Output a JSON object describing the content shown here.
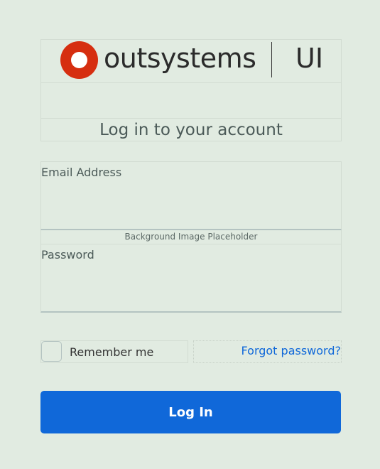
{
  "header": {
    "logo_icon": "outsystems-logo-icon",
    "logo_text": "outsystems",
    "logo_suffix": "UI",
    "brand_color": "#d62e10"
  },
  "login": {
    "title": "Log in to your account",
    "email": {
      "label": "Email Address",
      "value": "",
      "placeholder": ""
    },
    "background_placeholder": "Background Image Placeholder",
    "password": {
      "label": "Password",
      "value": "",
      "placeholder": ""
    },
    "remember_me": {
      "label": "Remember me",
      "checked": false
    },
    "forgot_password": "Forgot password?",
    "submit_label": "Log In",
    "accent_color": "#1068d9"
  }
}
